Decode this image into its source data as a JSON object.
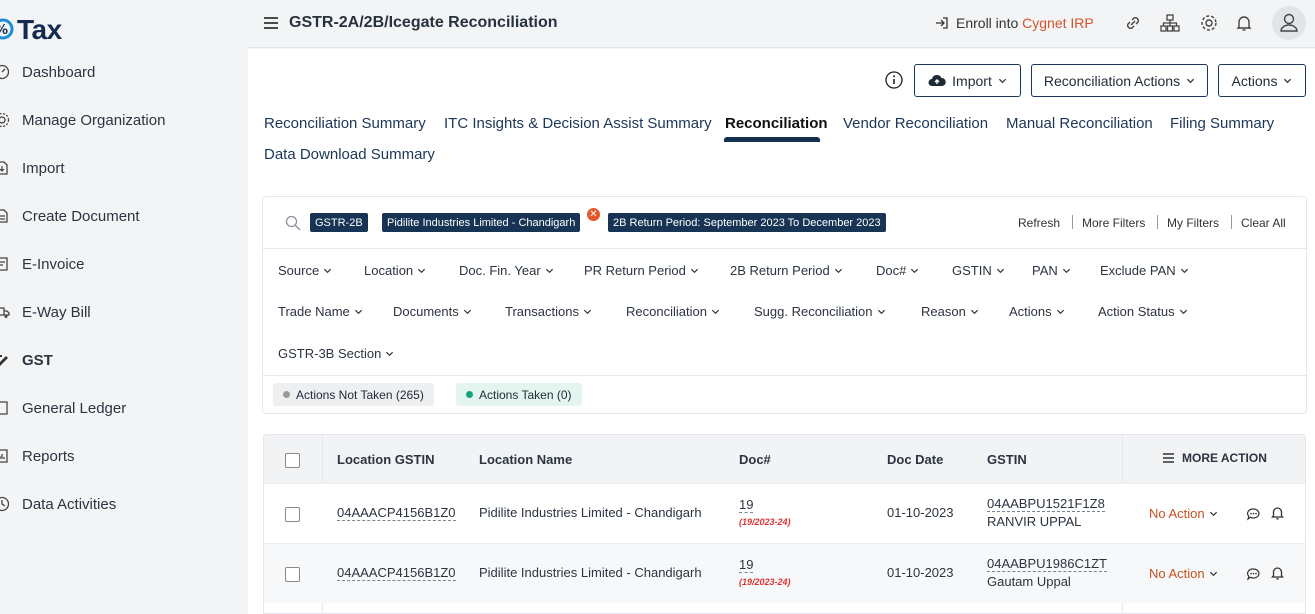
{
  "sidebar": {
    "logo_text": "Tax",
    "items": [
      {
        "label": "Dashboard",
        "icon": "dashboard-icon"
      },
      {
        "label": "Manage Organization",
        "icon": "gear-icon"
      },
      {
        "label": "Import",
        "icon": "import-icon"
      },
      {
        "label": "Create Document",
        "icon": "document-icon"
      },
      {
        "label": "E-Invoice",
        "icon": "invoice-icon"
      },
      {
        "label": "E-Way Bill",
        "icon": "truck-icon"
      },
      {
        "label": "GST",
        "icon": "gst-icon"
      },
      {
        "label": "General Ledger",
        "icon": "ledger-icon"
      },
      {
        "label": "Reports",
        "icon": "reports-icon"
      },
      {
        "label": "Data Activities",
        "icon": "activities-icon"
      }
    ]
  },
  "header": {
    "title": "GSTR-2A/2B/Icegate Reconciliation",
    "enroll_prefix": "Enroll into ",
    "enroll_brand": "Cygnet IRP"
  },
  "toolbar": {
    "import_label": "Import",
    "recon_actions_label": "Reconciliation Actions",
    "actions_label": "Actions"
  },
  "tabs": [
    "Reconciliation Summary",
    "ITC Insights & Decision Assist Summary",
    "Reconciliation",
    "Vendor Reconciliation",
    "Manual Reconciliation",
    "Filing Summary",
    "Data Download Summary"
  ],
  "filters": {
    "chips": [
      "GSTR-2B",
      "Pidilite Industries Limited - Chandigarh",
      "2B Return Period: September 2023 To December 2023"
    ],
    "links": [
      "Refresh",
      "More Filters",
      "My Filters",
      "Clear All"
    ],
    "dropdowns_row1": [
      "Source",
      "Location",
      "Doc. Fin. Year",
      "PR Return Period",
      "2B Return Period",
      "Doc#",
      "GSTIN",
      "PAN",
      "Exclude PAN"
    ],
    "dropdowns_row2": [
      "Trade Name",
      "Documents",
      "Transactions",
      "Reconciliation",
      "Sugg. Reconciliation",
      "Reason",
      "Actions",
      "Action Status"
    ],
    "dropdowns_row3": [
      "GSTR-3B Section"
    ],
    "status_not_taken": "Actions Not Taken (265)",
    "status_taken": "Actions Taken (0)"
  },
  "table": {
    "columns": [
      "Location GSTIN",
      "Location Name",
      "Doc#",
      "Doc Date",
      "GSTIN"
    ],
    "more_action": "MORE ACTION",
    "rows": [
      {
        "location_gstin": "04AAACP4156B1Z0",
        "location_name": "Pidilite Industries Limited - Chandigarh",
        "doc": "19",
        "doc_sub": "(19/2023-24)",
        "doc_date": "01-10-2023",
        "gstin": "04AABPU1521F1Z8",
        "trade_name": "RANVIR UPPAL",
        "action": "No Action"
      },
      {
        "location_gstin": "04AAACP4156B1Z0",
        "location_name": "Pidilite Industries Limited - Chandigarh",
        "doc": "19",
        "doc_sub": "(19/2023-24)",
        "doc_date": "01-10-2023",
        "gstin": "04AABPU1986C1ZT",
        "trade_name": "Gautam Uppal",
        "action": "No Action"
      }
    ]
  },
  "colors": {
    "brand_navy": "#173454",
    "accent_orange": "#d2542b",
    "status_grey": "#999999",
    "status_green": "#14a37f"
  }
}
